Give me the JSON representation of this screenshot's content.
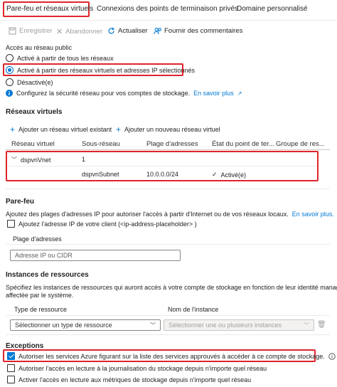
{
  "tabs": [
    {
      "label": "Pare-feu et réseaux virtuels"
    },
    {
      "label": "Connexions des points de terminaison privés"
    },
    {
      "label": "Domaine personnalisé"
    }
  ],
  "toolbar": {
    "save": "Enregistrer",
    "discard": "Abandonner",
    "refresh": "Actualiser",
    "feedback": "Fournir des commentaires"
  },
  "public_access": {
    "label": "Accès au réseau public",
    "options": [
      "Activé à partir de tous les réseaux",
      "Activé à partir des réseaux virtuels et adresses IP sélectionnés",
      "Désactivé(e)"
    ],
    "selected_index": 1,
    "info_text": "Configurez la sécurité réseau pour vos comptes de stockage.",
    "info_link": "En savoir plus"
  },
  "vnets": {
    "title": "Réseaux virtuels",
    "add_existing": "Ajouter un réseau virtuel existant",
    "add_new": "Ajouter un nouveau réseau virtuel",
    "columns": [
      "Réseau virtuel",
      "Sous-réseau",
      "Plage d'adresses",
      "État du point de ter...",
      "Groupe de res..."
    ],
    "rows": [
      {
        "vnet": "dspvnVnet",
        "subnet": "1",
        "range": "",
        "state": "",
        "group": ""
      },
      {
        "vnet": "",
        "subnet": "dspvnSubnet",
        "range": "10.0.0.0/24",
        "state": "Activé(e)",
        "group": ""
      }
    ]
  },
  "firewall": {
    "title": "Pare-feu",
    "description": "Ajoutez des plages d'adresses IP pour autoriser l'accès à partir d'Internet ou de vos réseaux locaux.",
    "link": "En savoir plus.",
    "client_ip": "Ajoutez l'adresse IP de votre client (<ip-address-placeholder> )",
    "range_label": "Plage d'adresses",
    "range_placeholder": "Adresse IP ou CIDR"
  },
  "instances": {
    "title": "Instances de ressources",
    "description_1": "Spécifiez les instances de ressources qui auront accès à votre compte de stockage en fonction de leur identité managée",
    "description_2": "affectée par le système.",
    "col_type": "Type de ressource",
    "col_name": "Nom de l'instance",
    "type_placeholder": "Sélectionner un type de ressource",
    "name_placeholder": "Sélectionner une ou plusieurs instances"
  },
  "exceptions": {
    "title": "Exceptions",
    "items": [
      {
        "label": "Autoriser les services Azure figurant sur la liste des services approuvés à accéder à ce compte de stockage.",
        "checked": true
      },
      {
        "label": "Autoriser l'accès en lecture à la journalisation du stockage depuis n'importe quel réseau",
        "checked": false
      },
      {
        "label": "Activer l'accès en lecture aux métriques de stockage depuis n'importe quel réseau",
        "checked": false
      }
    ]
  },
  "colors": {
    "accent": "#0078d4",
    "highlight": "#e0242b"
  }
}
